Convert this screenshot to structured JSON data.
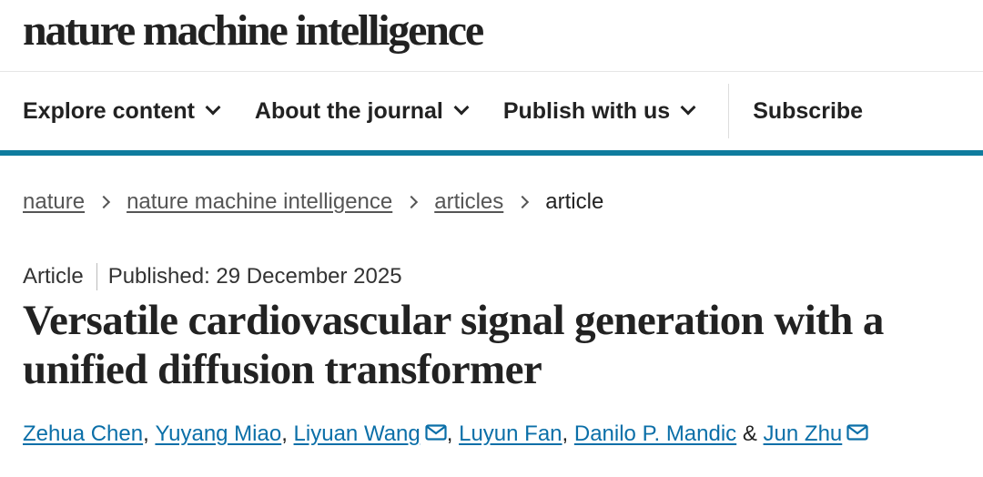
{
  "brand": {
    "logo_text": "nature machine intelligence"
  },
  "nav": {
    "items": [
      {
        "label": "Explore content",
        "dropdown": true
      },
      {
        "label": "About the journal",
        "dropdown": true
      },
      {
        "label": "Publish with us",
        "dropdown": true
      }
    ],
    "subscribe_label": "Subscribe",
    "accent_color": "#0f7c9e"
  },
  "breadcrumb": {
    "items": [
      "nature",
      "nature machine intelligence",
      "articles"
    ],
    "current": "article"
  },
  "article": {
    "type": "Article",
    "published": "Published: 29 December 2025",
    "title_line1": "Versatile cardiovascular signal generation with a",
    "title_line2": "unified diffusion transformer",
    "authors": [
      {
        "name": "Zehua Chen",
        "email_icon": false
      },
      {
        "name": "Yuyang Miao",
        "email_icon": false
      },
      {
        "name": "Liyuan Wang",
        "email_icon": true
      },
      {
        "name": "Luyun Fan",
        "email_icon": false
      },
      {
        "name": "Danilo P. Mandic",
        "email_icon": false
      },
      {
        "name": "Jun Zhu",
        "email_icon": true
      }
    ],
    "separator": ",",
    "conjunction": "&",
    "link_color": "#0b6fa8"
  }
}
